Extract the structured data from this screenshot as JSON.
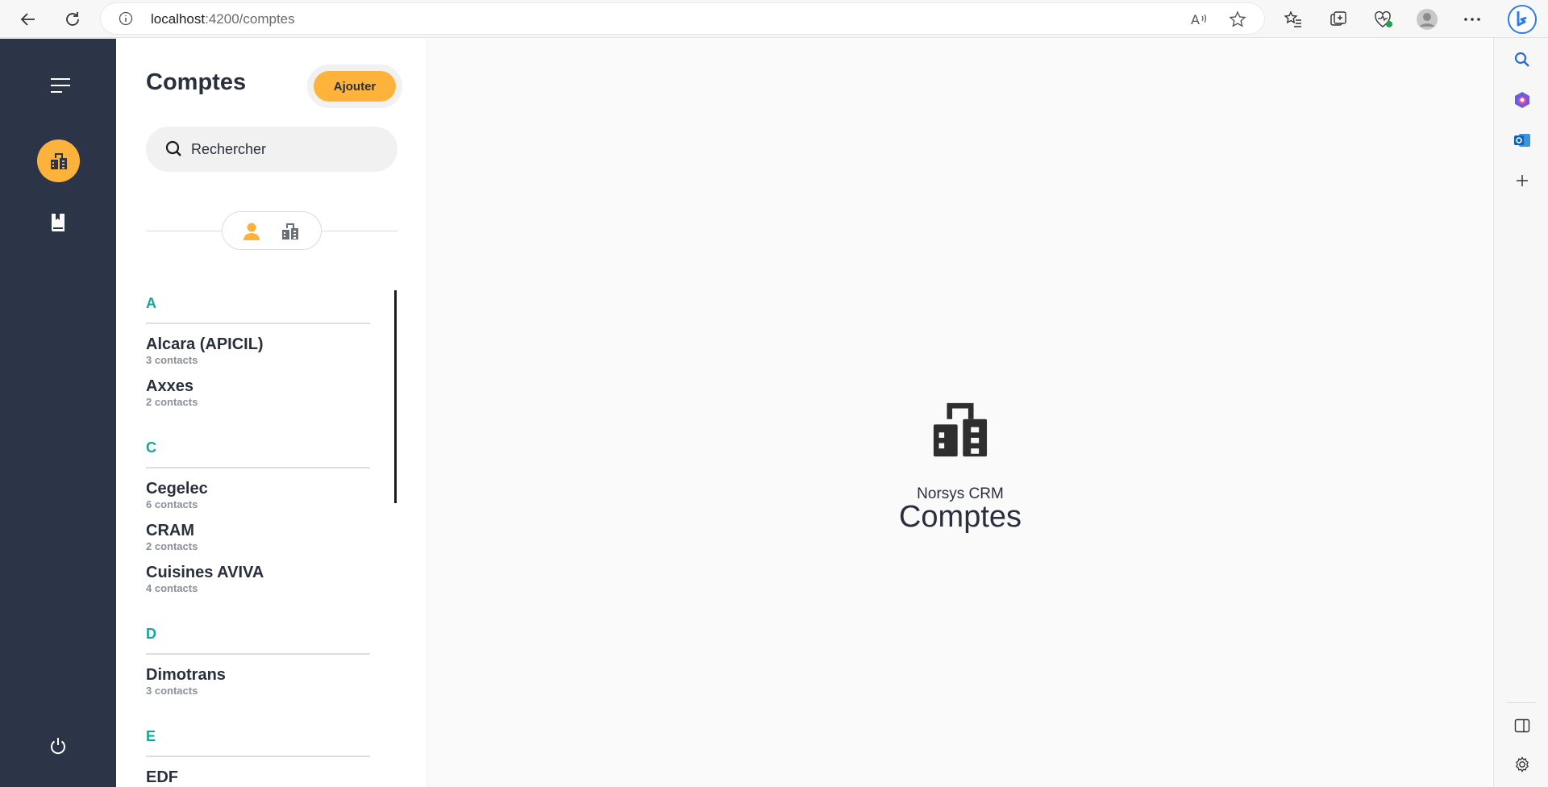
{
  "browser": {
    "url_host": "localhost",
    "url_path": ":4200/comptes"
  },
  "header": {
    "title": "Comptes",
    "add_label": "Ajouter"
  },
  "search": {
    "placeholder": "Rechercher"
  },
  "groups": [
    {
      "letter": "A",
      "accounts": [
        {
          "name": "Alcara (APICIL)",
          "contacts": "3 contacts"
        },
        {
          "name": "Axxes",
          "contacts": "2 contacts"
        }
      ]
    },
    {
      "letter": "C",
      "accounts": [
        {
          "name": "Cegelec",
          "contacts": "6 contacts"
        },
        {
          "name": "CRAM",
          "contacts": "2 contacts"
        },
        {
          "name": "Cuisines AVIVA",
          "contacts": "4 contacts"
        }
      ]
    },
    {
      "letter": "D",
      "accounts": [
        {
          "name": "Dimotrans",
          "contacts": "3 contacts"
        }
      ]
    },
    {
      "letter": "E",
      "accounts": [
        {
          "name": "EDF",
          "contacts": ""
        }
      ]
    }
  ],
  "main": {
    "brand": "Norsys CRM",
    "title": "Comptes"
  },
  "colors": {
    "accent": "#fdb33b",
    "sidebar": "#2c3547",
    "letter": "#14a89a"
  },
  "icons": {
    "sidebar": [
      "menu-icon",
      "building-icon",
      "book-icon",
      "power-icon"
    ],
    "toggle": [
      "person-icon",
      "building-icon"
    ]
  }
}
